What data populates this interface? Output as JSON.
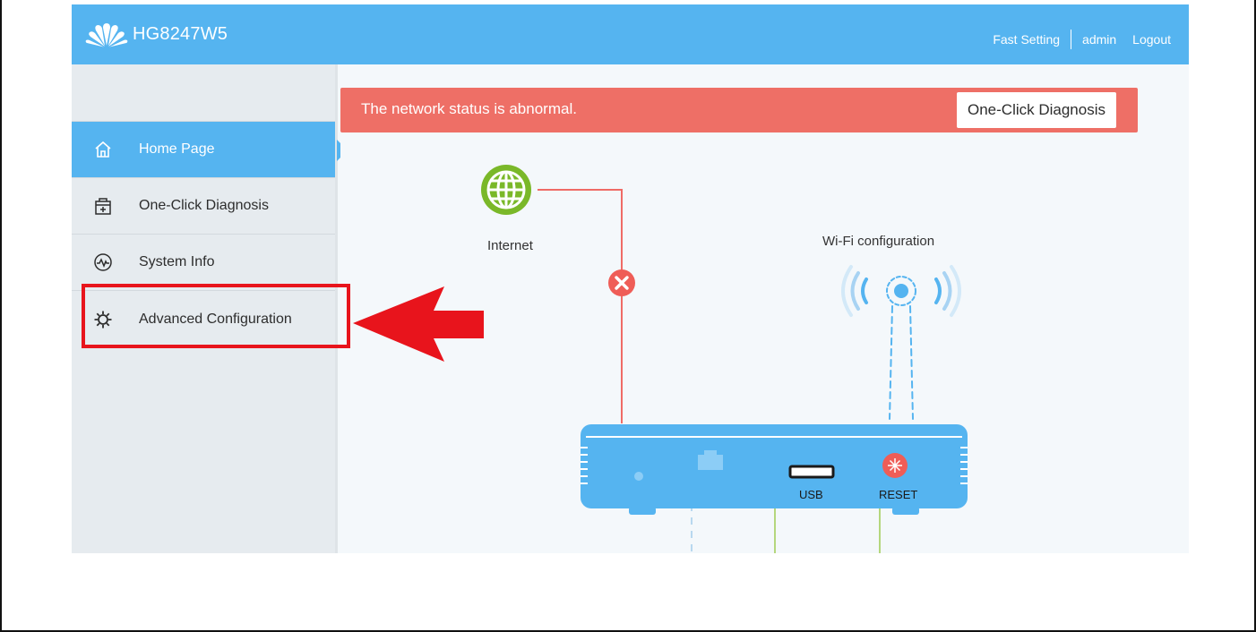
{
  "header": {
    "device_name": "HG8247W5",
    "links": [
      "Fast Setting",
      "admin",
      "Logout"
    ]
  },
  "sidebar": {
    "items": [
      {
        "label": "Home Page",
        "icon": "home-icon",
        "active": true
      },
      {
        "label": "One-Click Diagnosis",
        "icon": "medical-kit-icon",
        "active": false
      },
      {
        "label": "System Info",
        "icon": "pulse-icon",
        "active": false
      },
      {
        "label": "Advanced Configuration",
        "icon": "gear-icon",
        "active": false
      }
    ]
  },
  "alert": {
    "message": "The network status is abnormal.",
    "button_label": "One-Click Diagnosis"
  },
  "diagram": {
    "internet_label": "Internet",
    "wifi_label": "Wi-Fi configuration",
    "usb_label": "USB",
    "reset_label": "RESET"
  },
  "colors": {
    "accent": "#55b4f0",
    "alert": "#ee6f66",
    "internet_globe": "#7ab829",
    "error": "#ef5d57",
    "annotation_red": "#e8141c"
  }
}
